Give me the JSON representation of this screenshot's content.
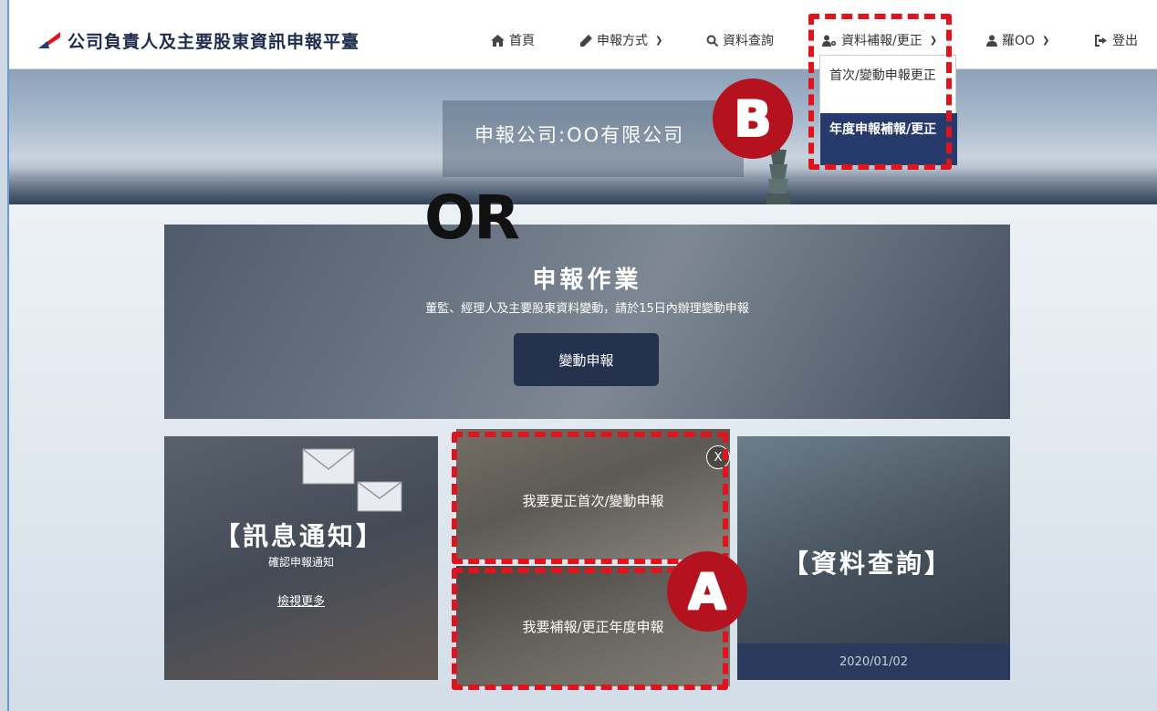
{
  "brand": {
    "title": "公司負責人及主要股東資訊申報平臺"
  },
  "nav": {
    "home": "首頁",
    "report_method": "申報方式",
    "data_query": "資料查詢",
    "data_supplement": "資料補報/更正",
    "user": "羅OO",
    "logout": "登出"
  },
  "dropdown": {
    "item1": "首次/變動申報更正",
    "item2": "年度申報補報/更正"
  },
  "banner": {
    "title": "申報公司:OO有限公司"
  },
  "annotations": {
    "or": "OR",
    "label_a": "A",
    "label_b": "B"
  },
  "main_card": {
    "title": "申報作業",
    "subtitle": "董監、經理人及主要股東資料變動，請於15日內辦理變動申報",
    "button": "變動申報"
  },
  "message_card": {
    "title": "【訊息通知】",
    "subtitle": "確認申報通知",
    "link": "檢視更多"
  },
  "correction_card": {
    "option1": "我要更正首次/變動申報",
    "option2": "我要補報/更正年度申報",
    "close": "X"
  },
  "query_card": {
    "title": "【資料查詢】",
    "date": "2020/01/02"
  },
  "colors": {
    "navy": "#273a6c",
    "highlight_red": "#e0141c",
    "label_red": "#b4121f"
  }
}
